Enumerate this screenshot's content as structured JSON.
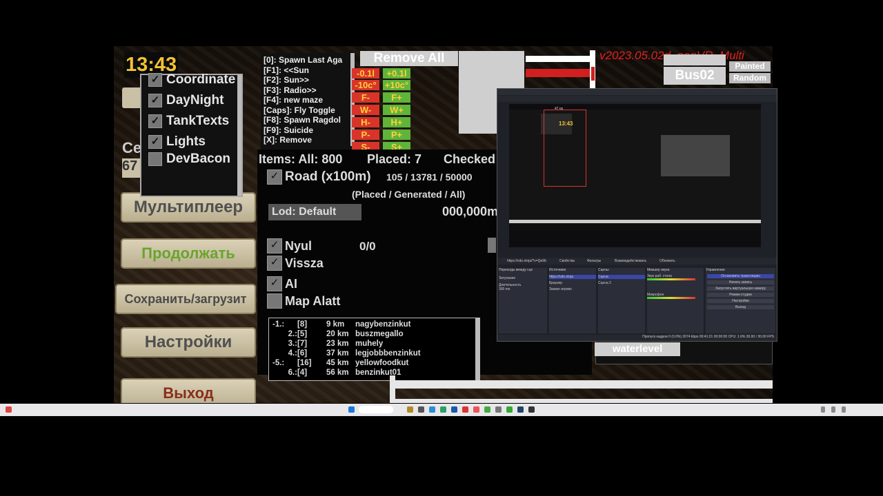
{
  "game": {
    "clock": "13:43",
    "version": "v2023.05.02d_nonVR_Multi",
    "remove_all": "Remove All",
    "menu": {
      "multiplayer": "Мультиплеер",
      "continue": "Продолжать",
      "save_load": "Сохранить/загрузит",
      "settings": "Настройки",
      "exit": "Выход"
    },
    "dropdown_items": [
      "Coordinate",
      "DayNight",
      "TankTexts",
      "Lights",
      "DevBacon"
    ],
    "hidden_left_label": "Се",
    "hidden_left_value": "67",
    "keys": [
      "[0]: Spawn Last Aga",
      "[F1]: <<Sun",
      "[F2]: Sun>>",
      "[F3]: Radio>>",
      "[F4]: new maze",
      "[Caps]: Fly Toggle",
      "[F8]: Spawn Ragdol",
      "[F9]: Suicide",
      "[X]: Remove"
    ],
    "adjust_buttons": [
      [
        "-0.1l",
        "+0.1l"
      ],
      [
        "-10c°",
        "+10c°"
      ],
      [
        "F-",
        "F+"
      ],
      [
        "W-",
        "W+"
      ],
      [
        "H-",
        "H+"
      ],
      [
        "P-",
        "P+"
      ],
      [
        "S-",
        "S+"
      ]
    ],
    "bus_buttons": [
      "Bus02"
    ],
    "side_buttons": [
      "Painted",
      "Random"
    ],
    "waterlevel": "waterlevel",
    "items_header": {
      "all": "Items: All: 800",
      "placed": "Placed: 7",
      "checked": "Checked"
    },
    "road_label": "Road (x100m)",
    "road_stats": "105 / 13781 / 50000",
    "road_stats_caption": "(Placed / Generated / All)",
    "lod": "Lod: Default",
    "coord_value": "000,000m",
    "options": [
      {
        "label": "Nyul",
        "checked": true
      },
      {
        "label": "Vissza",
        "checked": true
      },
      {
        "label": "AI",
        "checked": true
      },
      {
        "label": "Map Alatt",
        "checked": false
      }
    ],
    "nyul_value": "0/0",
    "list": [
      {
        "idx": "-1.:",
        "id": "[8]",
        "dist": "9 km",
        "name": "nagybenzinkut"
      },
      {
        "idx": "2.:",
        "id": "[5]",
        "dist": "20 km",
        "name": "buszmegallo"
      },
      {
        "idx": "3.:",
        "id": "[7]",
        "dist": "23 km",
        "name": "muhely"
      },
      {
        "idx": "4.:",
        "id": "[6]",
        "dist": "37 km",
        "name": "legjobbbenzinkut"
      },
      {
        "idx": "-5.:",
        "id": "[16]",
        "dist": "45 km",
        "name": "yellowfoodkut"
      },
      {
        "idx": "6.:",
        "id": "[4]",
        "dist": "56 km",
        "name": "benzinkut01"
      }
    ]
  },
  "obs": {
    "preview_label": "47 px",
    "source_title": "https://vdo.ninja/?v=Qe9b",
    "toolbar": [
      "Свойства",
      "Фильтры",
      "Взаимодействовать",
      "Обновить"
    ],
    "panels": [
      "Переходы между сце",
      "Источники",
      "Сцены",
      "Микшер звука",
      "Управление"
    ],
    "sources": [
      "https://vdo.ninja",
      "Браузер",
      "Захват игрово"
    ],
    "scenes": [
      "Сцена",
      "Сцена 2"
    ],
    "transition": "Затухание",
    "duration_label": "Длительность",
    "duration_value": "300 ms",
    "mixer": [
      "Звук раб. стола",
      "Микрофон"
    ],
    "controls": [
      "Остановить трансляцию",
      "Начать запись",
      "Запустить виртуальную камеру",
      "Режим студии",
      "Настройки",
      "Выход"
    ],
    "status": "Пропуск кадров 0 (0.0%)   2074 kbps   00:41:21   00:00:00   CPU: 1.6%   30.00 / 30.00 FPS"
  },
  "colors": {
    "accent_gold": "#f2c230",
    "version_red": "#e02020",
    "btn_red": "#d9342a",
    "btn_green": "#5fb43a",
    "obs_blue": "#3a47a8"
  }
}
